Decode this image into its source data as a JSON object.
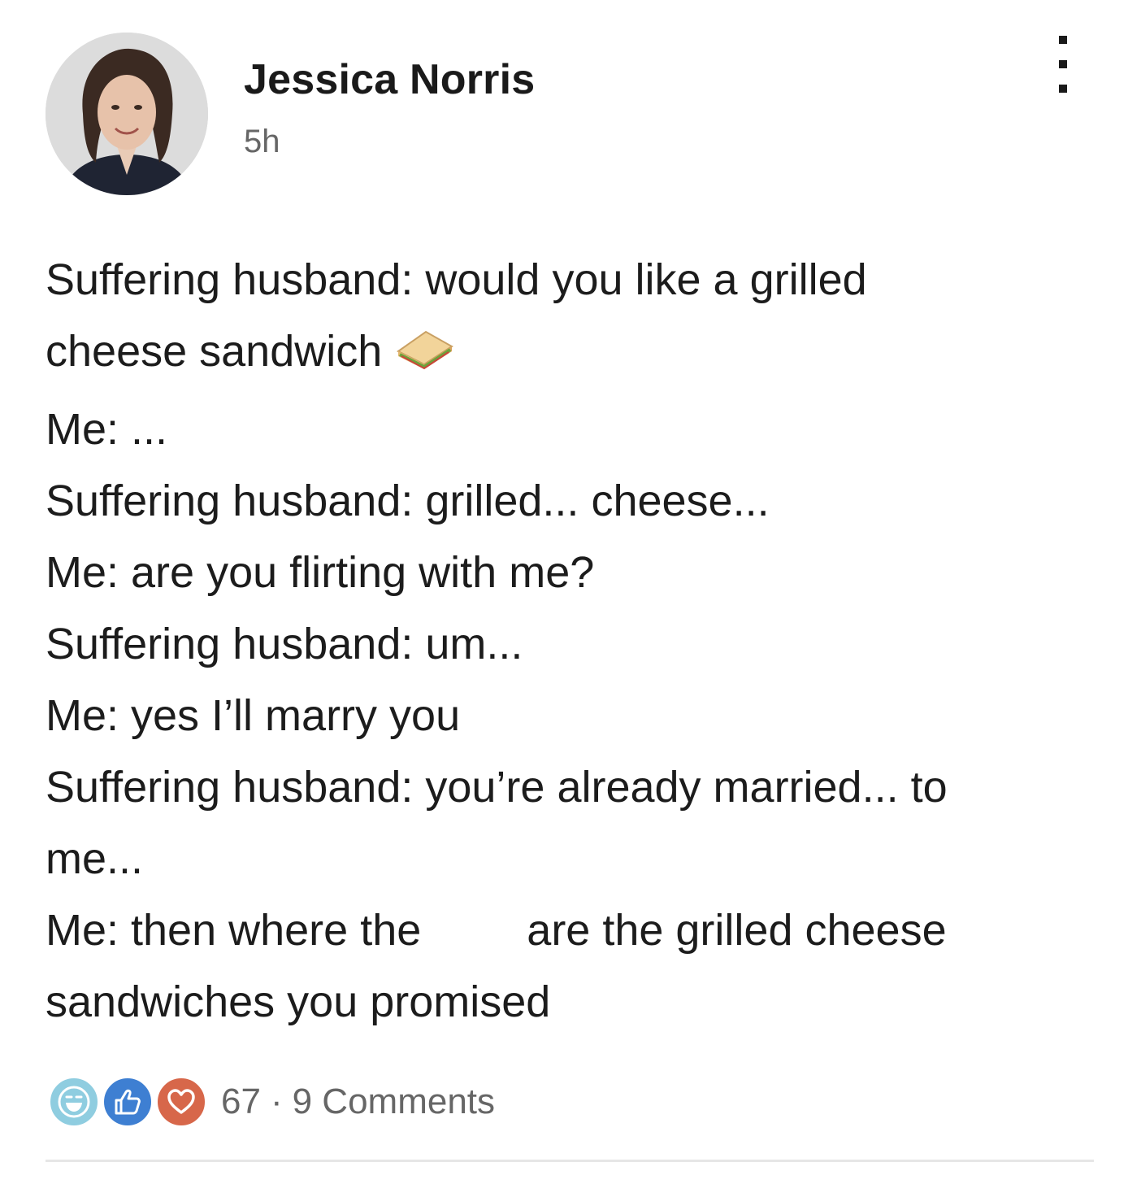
{
  "author": {
    "name": "Jessica Norris",
    "time": "5h"
  },
  "icons": {
    "avatar": "profile-photo",
    "more": "vertical-ellipsis-icon",
    "sandwich": "sandwich-emoji",
    "reactions": [
      "funny-reaction-icon",
      "like-reaction-icon",
      "love-reaction-icon"
    ]
  },
  "post": {
    "lines": [
      "Suffering husband: would you like a grilled",
      "cheese sandwich",
      "Me: ...",
      "Suffering husband: grilled... cheese...",
      "Me: are you flirting with me?",
      "Suffering husband: um...",
      "Me: yes I’ll marry you",
      "Suffering husband: you’re already married... to",
      "me...",
      "Me: then where the",
      "are the grilled cheese",
      "sandwiches you promised"
    ]
  },
  "footer": {
    "reaction_count": "67",
    "separator": "·",
    "comments": "9 Comments"
  },
  "colors": {
    "funny": "#8fcde0",
    "like": "#3e7fd2",
    "love": "#d7674a",
    "text": "#1c1c1c",
    "muted": "#666666"
  }
}
